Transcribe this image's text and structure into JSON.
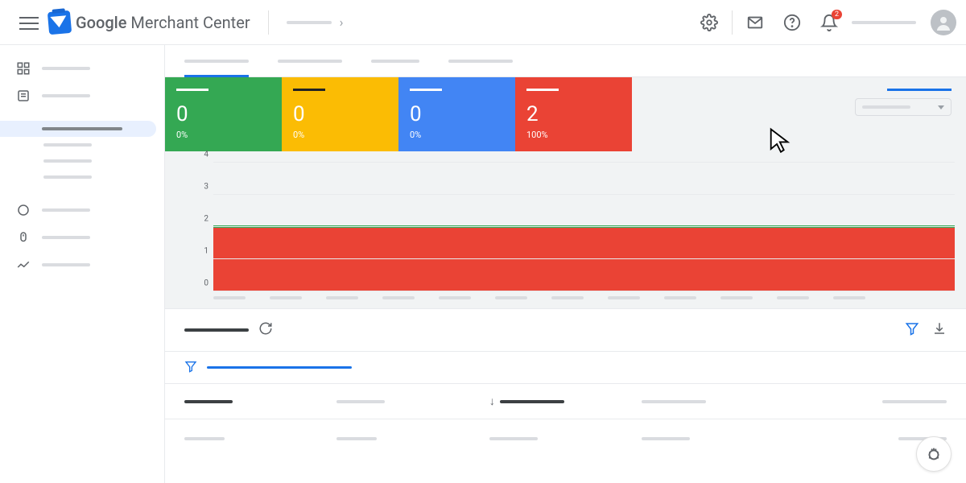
{
  "header": {
    "title_bold": "Google",
    "title_rest": " Merchant Center",
    "notification_count": "2"
  },
  "cards": [
    {
      "value": "0",
      "pct": "0%",
      "color": "c-green"
    },
    {
      "value": "0",
      "pct": "0%",
      "color": "c-yellow"
    },
    {
      "value": "0",
      "pct": "0%",
      "color": "c-blue"
    },
    {
      "value": "2",
      "pct": "100%",
      "color": "c-red"
    }
  ],
  "chart_data": {
    "type": "area",
    "ylim": [
      0,
      4
    ],
    "yticks": [
      "0",
      "1",
      "2",
      "3",
      "4"
    ],
    "series": [
      {
        "name": "red",
        "value": 2,
        "color": "#ea4335"
      },
      {
        "name": "green_line",
        "value": 2,
        "color": "#34a853"
      }
    ],
    "x_count": 12
  }
}
